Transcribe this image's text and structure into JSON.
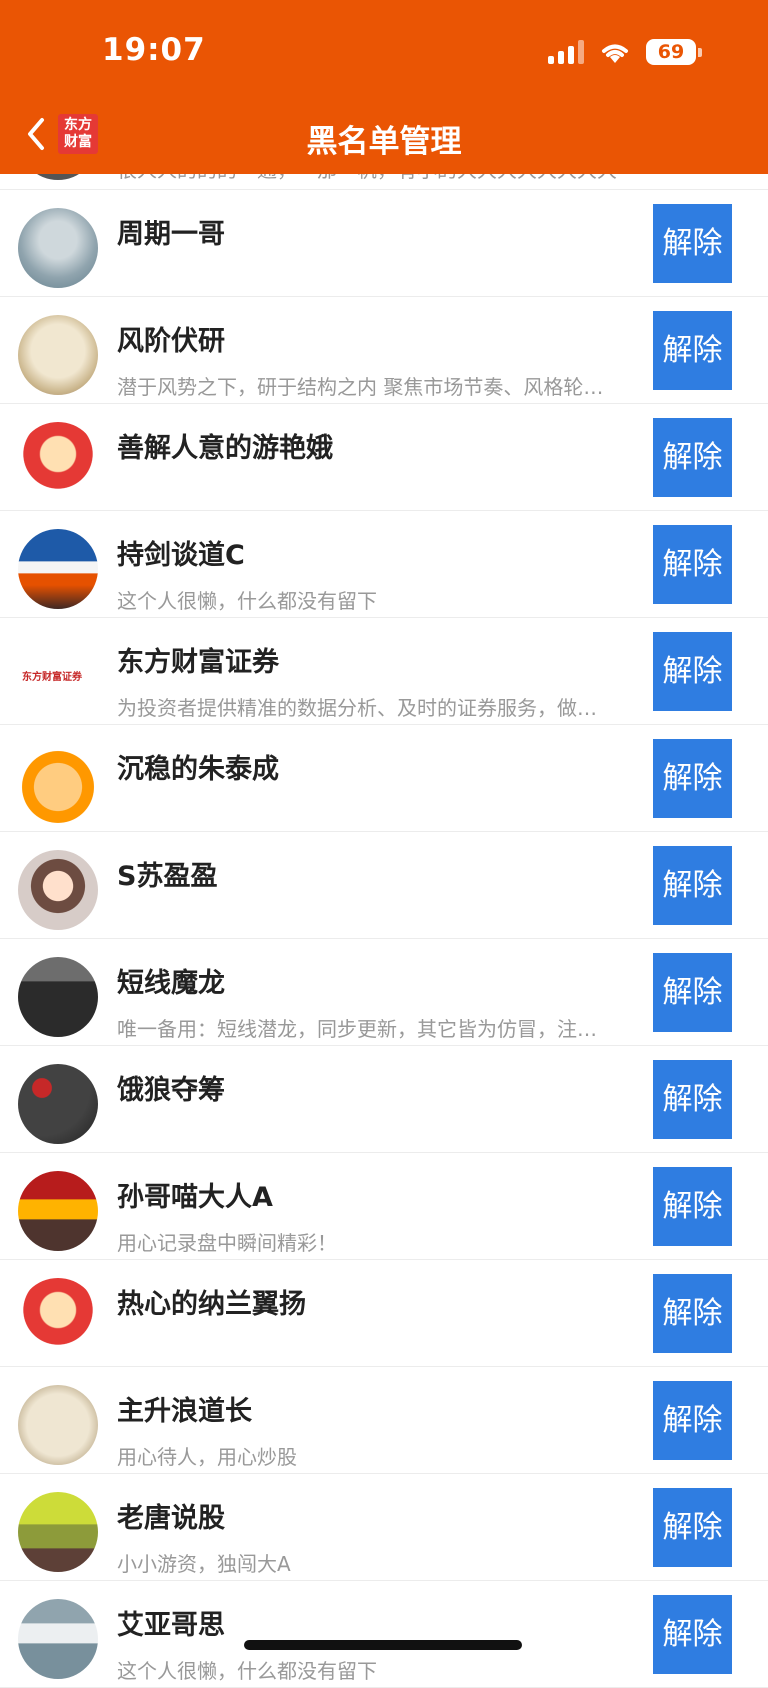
{
  "status_bar": {
    "time": "19:07",
    "battery": "69"
  },
  "nav": {
    "title": "黑名单管理",
    "logo_text": "东方\n财富"
  },
  "partial_top_desc": "很人人的的的一通，一那一帆，有小的大大大大大大大大",
  "users": [
    {
      "name": "周期一哥",
      "desc": "",
      "avatar": "rider"
    },
    {
      "name": "风阶伏研",
      "desc": "潜于风势之下，研于结构之内 聚焦市场节奏、风格轮…",
      "avatar": "feng"
    },
    {
      "name": "善解人意的游艳娥",
      "desc": "",
      "avatar": "caishen"
    },
    {
      "name": "持剑谈道C",
      "desc": "这个人很懒，什么都没有留下",
      "avatar": "mountain"
    },
    {
      "name": "东方财富证券",
      "desc": "为投资者提供精准的数据分析、及时的证券服务，做…",
      "avatar": "eastmoney"
    },
    {
      "name": "沉稳的朱泰成",
      "desc": "",
      "avatar": "dog"
    },
    {
      "name": "S苏盈盈",
      "desc": "",
      "avatar": "girl"
    },
    {
      "name": "短线魔龙",
      "desc": "唯一备用：短线潜龙，同步更新，其它皆为仿冒，注…",
      "avatar": "man"
    },
    {
      "name": "饿狼夺筹",
      "desc": "",
      "avatar": "wolf"
    },
    {
      "name": "孙哥喵大人A",
      "desc": "用心记录盘中瞬间精彩！",
      "avatar": "temple"
    },
    {
      "name": "热心的纳兰翼扬",
      "desc": "",
      "avatar": "caishen"
    },
    {
      "name": "主升浪道长",
      "desc": "用心待人，用心炒股",
      "avatar": "zhusheng"
    },
    {
      "name": "老唐说股",
      "desc": "小小游资，独闯大A",
      "avatar": "trees"
    },
    {
      "name": "艾亚哥思",
      "desc": "这个人很懒，什么都没有留下",
      "avatar": "clouds"
    }
  ],
  "button_label": "解除",
  "colors": {
    "header": "#ea5504",
    "button": "#2f7de1"
  }
}
